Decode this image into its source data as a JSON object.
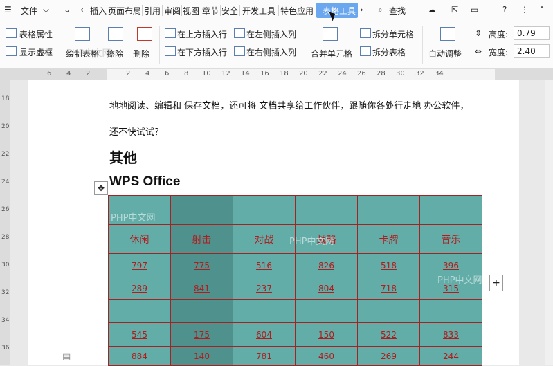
{
  "menu": {
    "file": "文件",
    "items": [
      "插入",
      "页面布局",
      "引用",
      "审阅",
      "视图",
      "章节",
      "安全",
      "开发工具",
      "特色应用"
    ],
    "active_tab": "表格工具",
    "search": "查找"
  },
  "toolbar": {
    "table_props": "表格属性",
    "show_gridlines": "显示虚框",
    "draw_table": "绘制表格",
    "eraser": "擦除",
    "delete": "删除",
    "insert_above": "在上方插入行",
    "insert_below": "在下方插入行",
    "insert_left": "在左侧插入列",
    "insert_right": "在右侧插入列",
    "merge_cells": "合并单元格",
    "split_cells": "拆分单元格",
    "split_table": "拆分表格",
    "auto_fit": "自动调整",
    "height_label": "高度:",
    "height_value": "0.79",
    "width_label": "宽度:",
    "width_value": "2.40"
  },
  "ruler": {
    "h": [
      "6",
      "4",
      "2",
      "2",
      "4",
      "6",
      "8",
      "10",
      "12",
      "14",
      "16",
      "18",
      "20",
      "22",
      "24",
      "26",
      "28",
      "30",
      "32",
      "34"
    ],
    "v": [
      "18",
      "20",
      "22",
      "24",
      "26",
      "28",
      "30",
      "32",
      "34",
      "36"
    ]
  },
  "doc": {
    "line1": "地地阅读、编辑和 保存文档，还可将 文档共享给工作伙伴，跟随你各处行走地 办公软件，",
    "line2": "还不快试试？",
    "heading1": "其他",
    "heading2": "WPS Office"
  },
  "table": {
    "rows": [
      [
        "",
        "",
        "",
        "",
        "",
        ""
      ],
      [
        "休闲",
        "射击",
        "对战",
        "战略",
        "卡牌",
        "音乐"
      ],
      [
        "797",
        "775",
        "516",
        "826",
        "518",
        "396"
      ],
      [
        "289",
        "841",
        "237",
        "804",
        "718",
        "315"
      ],
      [
        "",
        "",
        "",
        "",
        "",
        ""
      ],
      [
        "545",
        "175",
        "604",
        "150",
        "522",
        "833"
      ],
      [
        "884",
        "140",
        "781",
        "460",
        "269",
        "244"
      ]
    ]
  },
  "watermark": "PHP中文网"
}
